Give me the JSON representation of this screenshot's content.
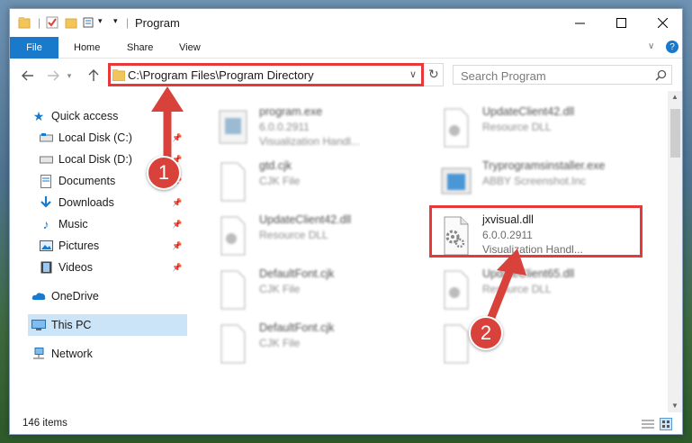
{
  "window": {
    "title": "Program"
  },
  "ribbon": {
    "tabs": [
      "File",
      "Home",
      "Share",
      "View"
    ]
  },
  "address": {
    "path": "C:\\Program Files\\Program Directory"
  },
  "search": {
    "placeholder": "Search Program"
  },
  "sidebar": {
    "items": [
      {
        "label": "Quick access",
        "icon": "star-icon"
      },
      {
        "label": "Local Disk (C:)",
        "icon": "drive-icon",
        "pinned": true
      },
      {
        "label": "Local Disk (D:)",
        "icon": "drive-icon",
        "pinned": true
      },
      {
        "label": "Documents",
        "icon": "documents-icon",
        "pinned": true
      },
      {
        "label": "Downloads",
        "icon": "downloads-icon",
        "pinned": true
      },
      {
        "label": "Music",
        "icon": "music-icon",
        "pinned": true
      },
      {
        "label": "Pictures",
        "icon": "pictures-icon",
        "pinned": true
      },
      {
        "label": "Videos",
        "icon": "videos-icon",
        "pinned": true
      },
      {
        "label": "OneDrive",
        "icon": "onedrive-icon"
      },
      {
        "label": "This PC",
        "icon": "pc-icon",
        "selected": true
      },
      {
        "label": "Network",
        "icon": "network-icon"
      }
    ]
  },
  "files": [
    {
      "name": "program.exe",
      "line2": "6.0.0.2911",
      "line3": "Visualization Handl...",
      "icon": "exe-icon"
    },
    {
      "name": "gtd.cjk",
      "line2": "CJK File",
      "line3": "",
      "icon": "file-icon"
    },
    {
      "name": "UpdateClient42.dll",
      "line2": "Resource DLL",
      "line3": "",
      "icon": "dll-icon"
    },
    {
      "name": "DefaultFont.cjk",
      "line2": "CJK File",
      "line3": "",
      "icon": "file-icon"
    },
    {
      "name": "DefaultFont.cjk",
      "line2": "CJK File",
      "line3": "",
      "icon": "file-icon"
    },
    {
      "name": "UpdateClient42.dll",
      "line2": "Resource DLL",
      "line3": "",
      "icon": "dll-icon"
    },
    {
      "name": "Tryprogramsinstaller.exe",
      "line2": "ABBY Screenshot.Inc",
      "line3": "",
      "icon": "installer-icon"
    },
    {
      "name": "jxvisual.dll",
      "line2": "6.0.0.2911",
      "line3": "Visualization Handl...",
      "icon": "dll-icon"
    },
    {
      "name": "UpdateClient65.dll",
      "line2": "Resource DLL",
      "line3": "",
      "icon": "dll-icon"
    },
    {
      "name": "",
      "line2": "",
      "line3": "",
      "icon": "file-icon"
    }
  ],
  "status": {
    "count": "146 items"
  },
  "callouts": [
    "1",
    "2"
  ],
  "colors": {
    "accent": "#1979ca",
    "highlight": "#e8393a",
    "selection": "#cce4f7"
  }
}
